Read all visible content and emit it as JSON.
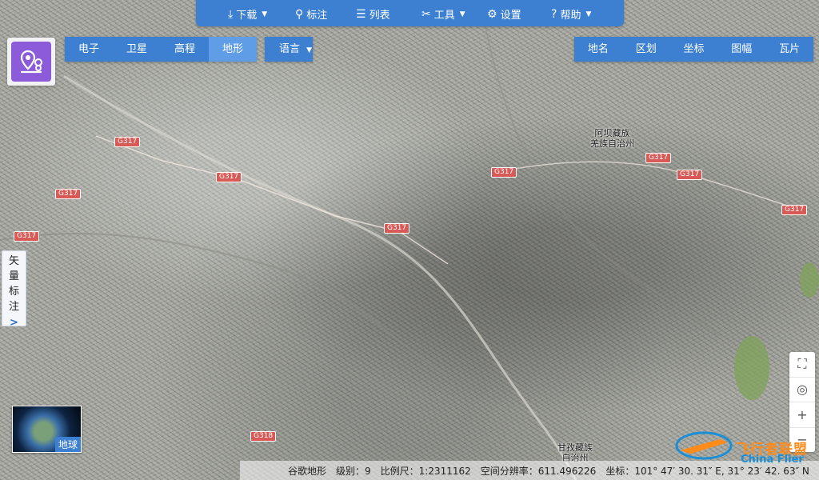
{
  "top_menu": {
    "download": "下载",
    "annotate": "标注",
    "list": "列表",
    "tools": "工具",
    "settings": "设置",
    "help": "帮助"
  },
  "map_types": [
    "电子",
    "卫星",
    "高程",
    "地形"
  ],
  "active_map_type": "地形",
  "language": "语言",
  "right_panel": [
    "地名",
    "区划",
    "坐标",
    "图幅",
    "瓦片"
  ],
  "side_tab": {
    "chars": [
      "矢",
      "量",
      "标",
      "注"
    ],
    "arrow": ">"
  },
  "globe": {
    "label": "地球"
  },
  "status": {
    "source": "谷歌地形",
    "level": "级别：9",
    "scale": "比例尺：1:2311162",
    "resolution": "空间分辨率：611.496226",
    "coords": "坐标：101° 47′ 30. 31″ E, 31° 23′ 42. 63″ N"
  },
  "roads": [
    "G317",
    "G317",
    "G317",
    "G317",
    "G317",
    "G317",
    "G317",
    "G317",
    "G317",
    "G318"
  ],
  "places": [
    {
      "name": "阿坝藏族\n羌族自治州"
    },
    {
      "name": "甘孜藏族\n自治州"
    }
  ],
  "watermark": {
    "cn": "飞行者联盟",
    "en": "China Flier"
  },
  "colors": {
    "accent": "#3d7fd0",
    "active_tab": "#5f9de6",
    "road": "#d85a56"
  }
}
